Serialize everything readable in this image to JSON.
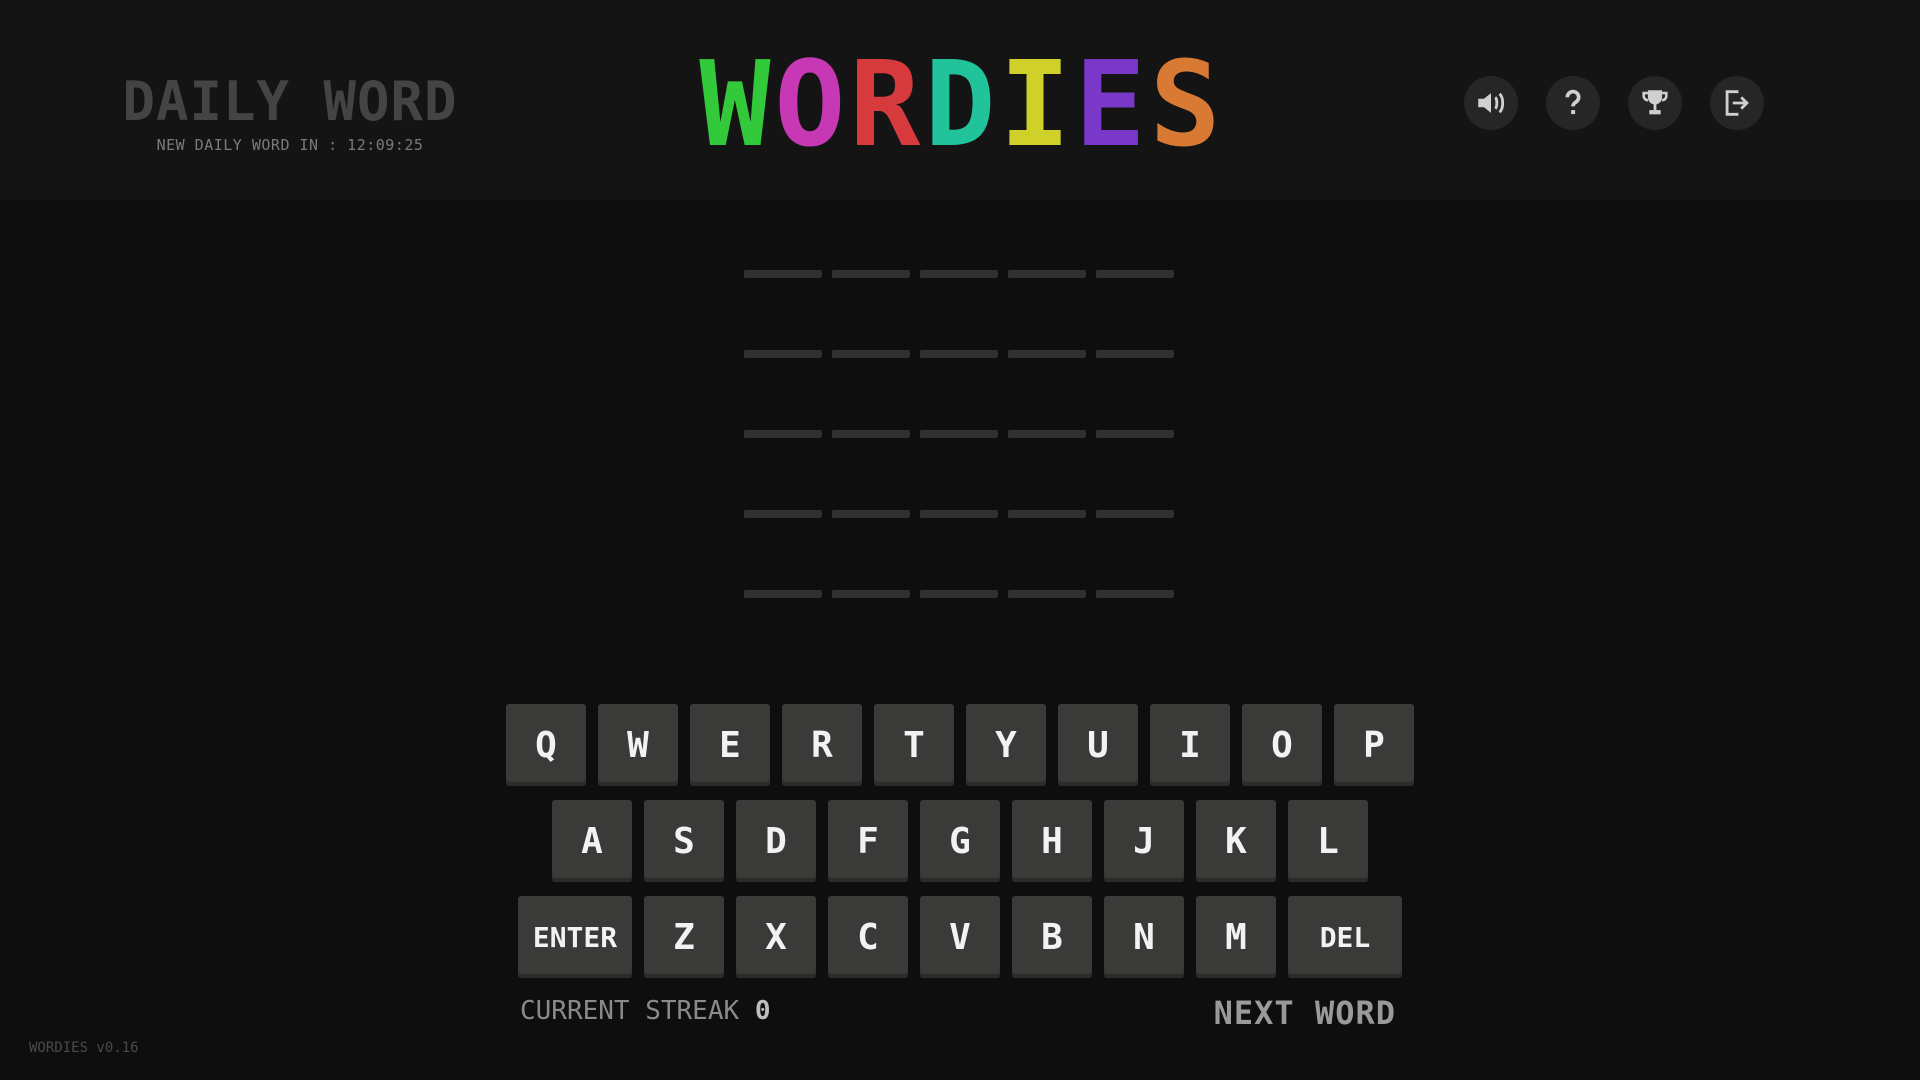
{
  "header": {
    "mode_title": "DAILY WORD",
    "countdown_label": "NEW DAILY WORD IN : 12:09:25",
    "logo_letters": [
      {
        "char": "W",
        "color": "#32c93a"
      },
      {
        "char": "O",
        "color": "#c638b4"
      },
      {
        "char": "R",
        "color": "#d63a3c"
      },
      {
        "char": "D",
        "color": "#20c39a"
      },
      {
        "char": "I",
        "color": "#cfd12a"
      },
      {
        "char": "E",
        "color": "#7a38c9"
      },
      {
        "char": "S",
        "color": "#d87a34"
      }
    ],
    "icons": [
      "speaker-icon",
      "help-icon",
      "trophy-icon",
      "exit-icon"
    ]
  },
  "board": {
    "rows": 5,
    "columns": 5
  },
  "keyboard": {
    "row1": [
      "Q",
      "W",
      "E",
      "R",
      "T",
      "Y",
      "U",
      "I",
      "O",
      "P"
    ],
    "row2": [
      "A",
      "S",
      "D",
      "F",
      "G",
      "H",
      "J",
      "K",
      "L"
    ],
    "row3": [
      "ENTER",
      "Z",
      "X",
      "C",
      "V",
      "B",
      "N",
      "M",
      "DEL"
    ]
  },
  "footer": {
    "streak_label": "CURRENT STREAK",
    "streak_value": "0",
    "next_word_label": "NEXT WORD",
    "version": "WORDIES v0.16"
  }
}
